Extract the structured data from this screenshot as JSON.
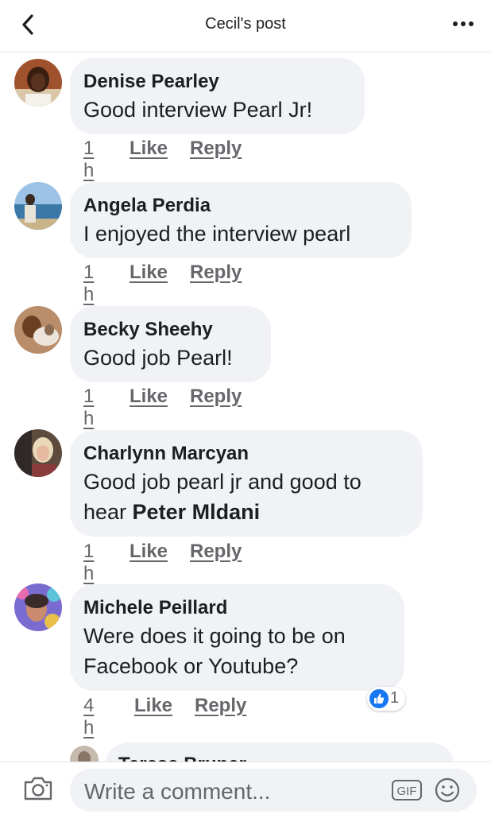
{
  "header": {
    "title": "Cecil's post"
  },
  "comments": [
    {
      "name": "Denise Pearley",
      "text": "Good interview Pearl Jr!",
      "time": "1 h",
      "like": "Like",
      "reply": "Reply"
    },
    {
      "name": "Angela Perdia",
      "text": "I enjoyed the interview pearl",
      "time": "1 h",
      "like": "Like",
      "reply": "Reply"
    },
    {
      "name": "Becky Sheehy",
      "text": "Good job Pearl!",
      "time": "1 h",
      "like": "Like",
      "reply": "Reply"
    },
    {
      "name": "Charlynn Marcyan",
      "text_line1": "Good job pearl jr and good to",
      "text_line2_prefix": "hear ",
      "mention": "Peter Mldani",
      "time": "1 h",
      "like": "Like",
      "reply": "Reply"
    },
    {
      "name": "Michele Peillard",
      "text_line1": "Were does it going to be on",
      "text_line2": "Facebook or Youtube?",
      "time": "4 h",
      "like": "Like",
      "reply": "Reply",
      "reaction_count": "1",
      "reaction_icon": "thumbs-up-icon"
    },
    {
      "name": "Teresa Bruner"
    }
  ],
  "composer": {
    "placeholder": "Write a comment...",
    "gif_label": "GIF"
  },
  "colors": {
    "bubble": "#f0f2f5",
    "meta_text": "#65676b",
    "like_blue": "#1877f2"
  }
}
